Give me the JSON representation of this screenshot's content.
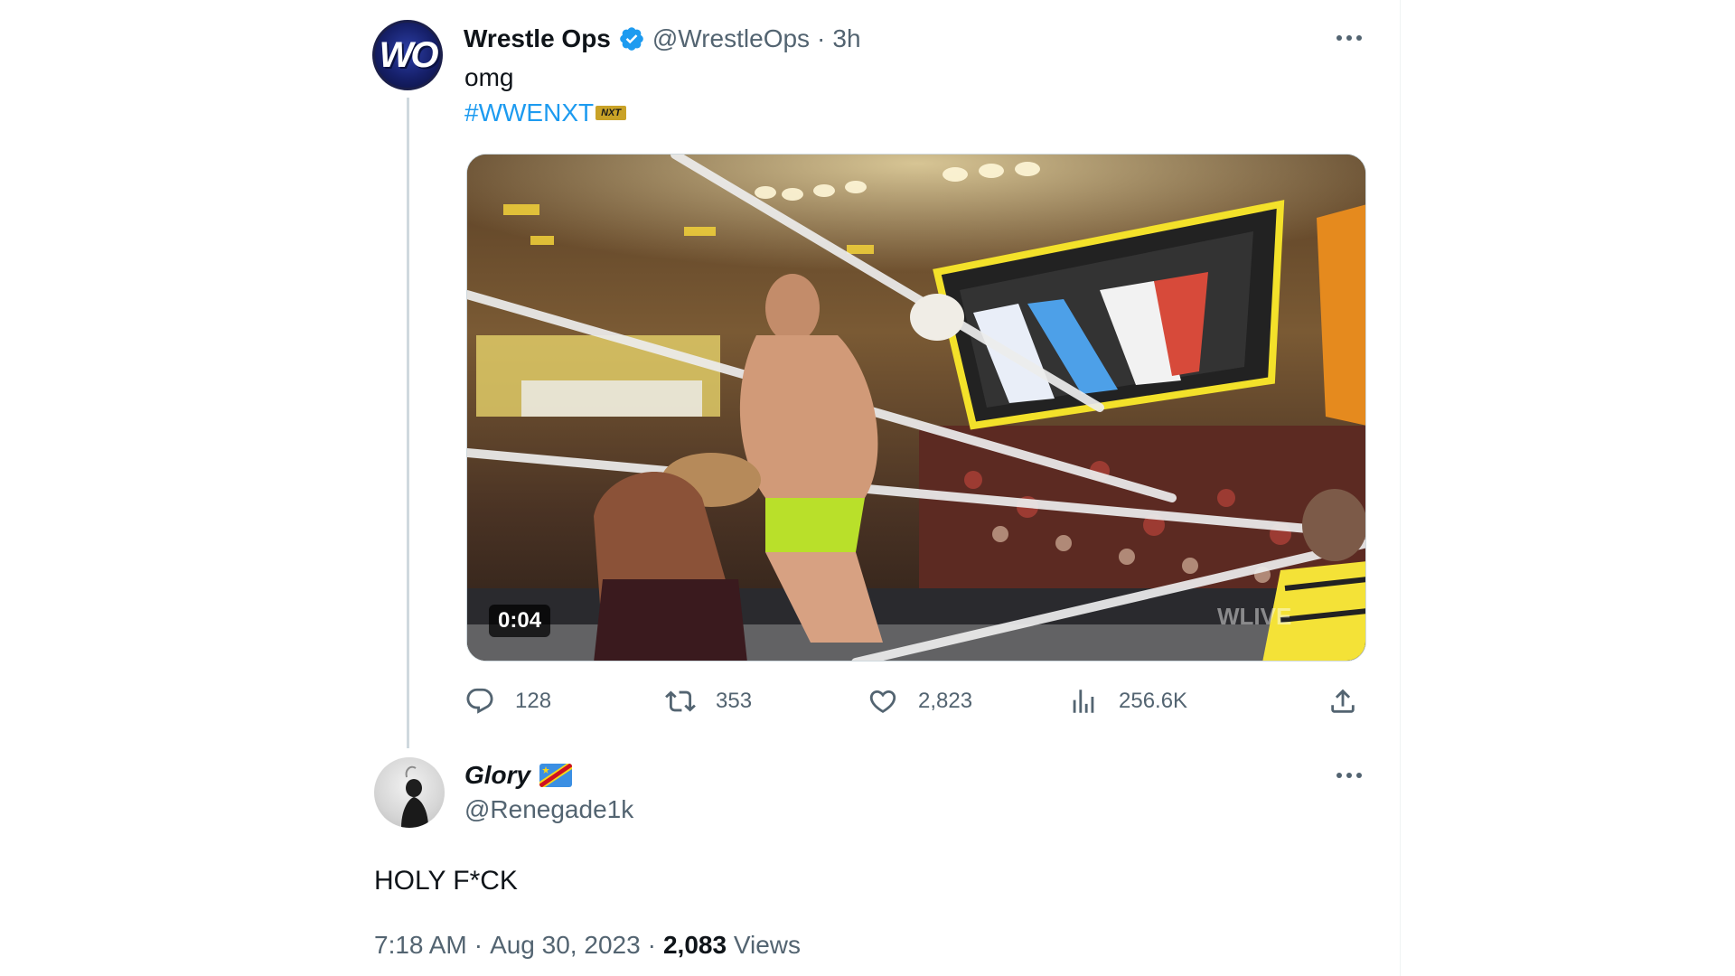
{
  "parent_tweet": {
    "avatar_text": "WO",
    "display_name": "Wrestle Ops",
    "handle": "@WrestleOps",
    "separator": "·",
    "time": "3h",
    "text": "omg",
    "hashtag": "#WWENXT",
    "hashtag_emoji": "NXT",
    "media": {
      "duration": "0:04"
    },
    "actions": {
      "replies": "128",
      "retweets": "353",
      "likes": "2,823",
      "views": "256.6K"
    }
  },
  "reply_tweet": {
    "display_name": "Glory",
    "handle": "@Renegade1k",
    "text": "HOLY F*CK",
    "meta": {
      "time": "7:18 AM",
      "separator": "·",
      "date": "Aug 30, 2023",
      "separator2": "·",
      "views_count": "2,083",
      "views_label": "Views"
    }
  },
  "colors": {
    "accent": "#1d9bf0",
    "secondary_text": "#536471",
    "primary_text": "#0f1419"
  }
}
